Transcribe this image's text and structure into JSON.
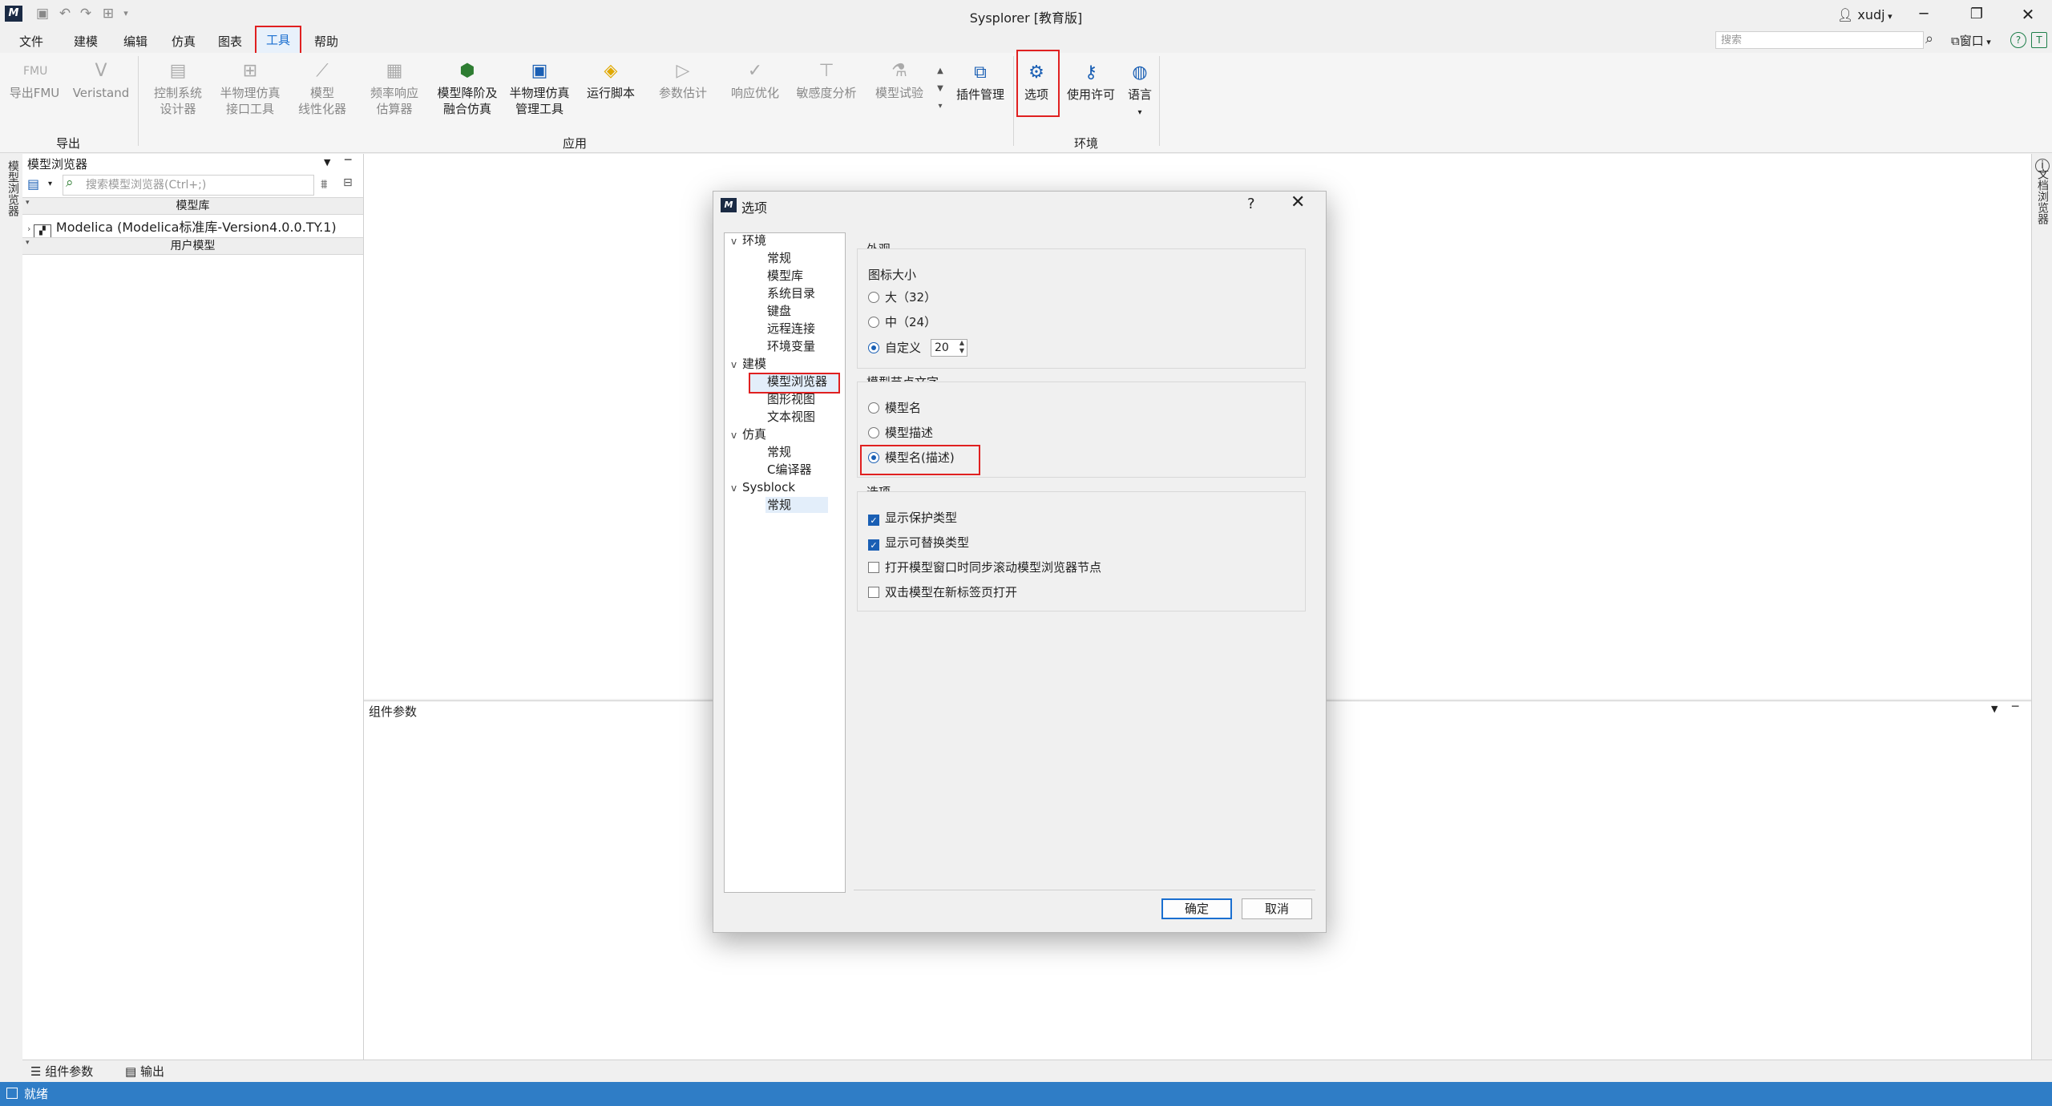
{
  "app": {
    "title": "Sysplorer [教育版]",
    "user": "xudj",
    "logo_glyph": "M"
  },
  "menu": {
    "items": [
      "文件",
      "建模",
      "编辑",
      "仿真",
      "图表",
      "工具",
      "帮助"
    ],
    "search_placeholder": "搜索",
    "window_label": "窗口"
  },
  "ribbon": {
    "export_group": "导出",
    "export_fmu": "导出FMU",
    "veristand": "Veristand",
    "apply_group": "应用",
    "control_design": "控制系统\n设计器",
    "semi_physical": "半物理仿真\n接口工具",
    "model_linearizer": "模型\n线性化器",
    "freq_response": "频率响应\n估算器",
    "reduced_order": "模型降阶及\n融合仿真",
    "semi_physical_mgmt": "半物理仿真\n管理工具",
    "run_script": "运行脚本",
    "param_estimation": "参数估计",
    "response_opt": "响应优化",
    "sensitivity": "敏感度分析",
    "model_test": "模型试验",
    "plugin_mgmt": "插件管理",
    "env_group": "环境",
    "options": "选项",
    "license": "使用许可",
    "language": "语言"
  },
  "left_panel": {
    "side_tab": "模型浏览器",
    "title": "模型浏览器",
    "search_placeholder": "搜索模型浏览器(Ctrl+;)",
    "lib_header": "模型库",
    "lib_item": "Modelica (Modelica标准库-Version4.0.0.TY.1)",
    "user_header": "用户模型"
  },
  "right_tab": "文档浏览器",
  "params_panel": {
    "title": "组件参数"
  },
  "bottom_tabs": {
    "params": "组件参数",
    "output": "输出"
  },
  "status": {
    "text": "就绪"
  },
  "dialog": {
    "title": "选项",
    "help": "?",
    "close": "✕",
    "tree": [
      {
        "label": "环境",
        "children": [
          "常规",
          "模型库",
          "系统目录",
          "键盘",
          "远程连接",
          "环境变量"
        ]
      },
      {
        "label": "建模",
        "children": [
          "模型浏览器",
          "图形视图",
          "文本视图"
        ]
      },
      {
        "label": "仿真",
        "children": [
          "常规",
          "C编译器"
        ]
      },
      {
        "label": "Sysblock",
        "children": [
          "常规"
        ]
      }
    ],
    "appearance": {
      "title": "外观",
      "icon_size_label": "图标大小",
      "large": "大（32）",
      "medium": "中（24）",
      "custom": "自定义",
      "custom_value": "20"
    },
    "node_text": {
      "title": "模型节点文字",
      "name": "模型名",
      "desc": "模型描述",
      "name_desc": "模型名(描述)"
    },
    "options": {
      "title": "选项",
      "show_protected": "显示保护类型",
      "show_replaceable": "显示可替换类型",
      "sync_scroll": "打开模型窗口时同步滚动模型浏览器节点",
      "open_new_tab": "双击模型在新标签页打开"
    },
    "ok": "确定",
    "cancel": "取消"
  }
}
